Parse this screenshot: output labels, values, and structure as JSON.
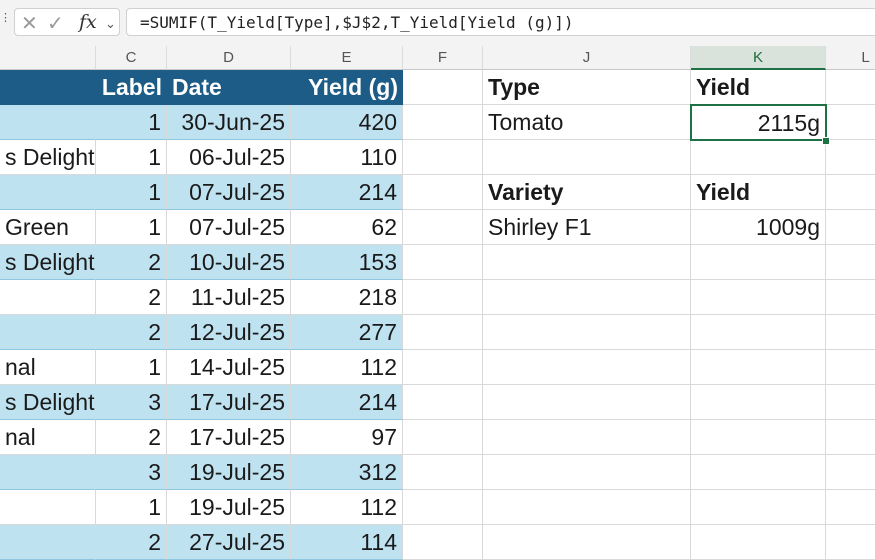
{
  "formula_bar": {
    "cancel_icon": "x-icon",
    "enter_icon": "check-icon",
    "function_icon": "fx-icon",
    "fx_label": "fx",
    "formula": "=SUMIF(T_Yield[Type],$J$2,T_Yield[Yield (g)])"
  },
  "columns": [
    "C",
    "D",
    "E",
    "F",
    "J",
    "K",
    "L"
  ],
  "table": {
    "headers": {
      "label": "Label",
      "date": "Date",
      "yield": "Yield (g)"
    },
    "rows": [
      {
        "b": "",
        "c": "1",
        "d": "30-Jun-25",
        "e": "420"
      },
      {
        "b": "s Delight",
        "c": "1",
        "d": "06-Jul-25",
        "e": "110"
      },
      {
        "b": "",
        "c": "1",
        "d": "07-Jul-25",
        "e": "214"
      },
      {
        "b": " Green",
        "c": "1",
        "d": "07-Jul-25",
        "e": "62"
      },
      {
        "b": "s Delight",
        "c": "2",
        "d": "10-Jul-25",
        "e": "153"
      },
      {
        "b": "",
        "c": "2",
        "d": "11-Jul-25",
        "e": "218"
      },
      {
        "b": "",
        "c": "2",
        "d": "12-Jul-25",
        "e": "277"
      },
      {
        "b": "nal",
        "c": "1",
        "d": "14-Jul-25",
        "e": "112"
      },
      {
        "b": "s Delight",
        "c": "3",
        "d": "17-Jul-25",
        "e": "214"
      },
      {
        "b": "nal",
        "c": "2",
        "d": "17-Jul-25",
        "e": "97"
      },
      {
        "b": "",
        "c": "3",
        "d": "19-Jul-25",
        "e": "312"
      },
      {
        "b": "",
        "c": "1",
        "d": "19-Jul-25",
        "e": "112"
      },
      {
        "b": "",
        "c": "2",
        "d": "27-Jul-25",
        "e": "114"
      }
    ]
  },
  "summary": {
    "type_label": "Type",
    "yield_label": "Yield",
    "type_value": "Tomato",
    "type_yield": "2115g",
    "variety_label": "Variety",
    "variety_yield_label": "Yield",
    "variety_value": "Shirley F1",
    "variety_yield": "1009g"
  },
  "colors": {
    "table_header": "#1d5c86",
    "band": "#bfe2f1",
    "selection": "#1e7145"
  }
}
